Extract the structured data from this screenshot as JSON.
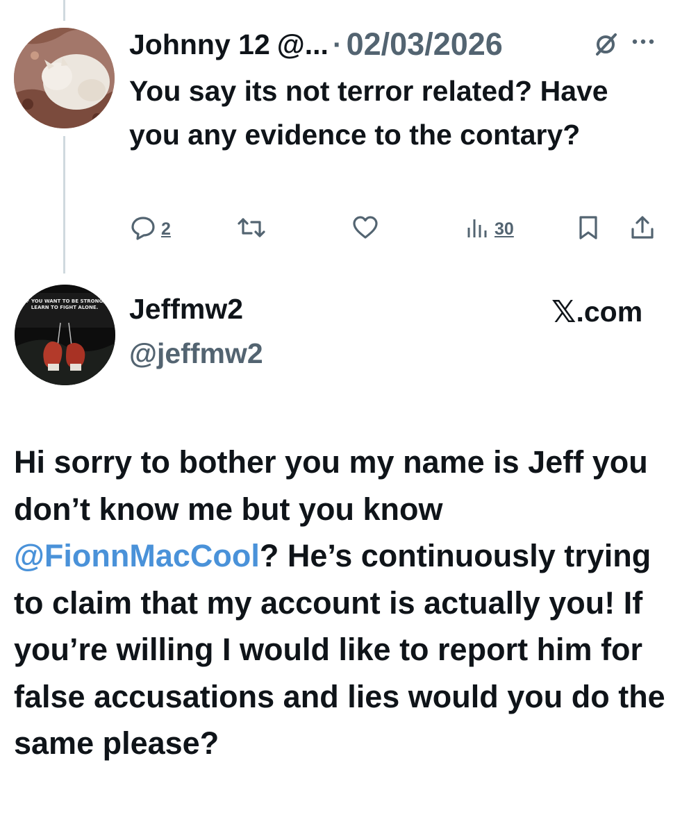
{
  "tweet1": {
    "author_name": "Johnny 12",
    "author_handle": "@...",
    "separator": "·",
    "date": "02/03/2026",
    "text": "You say its not terror related? Have you any evidence to the contary?",
    "replies": "2",
    "views": "30",
    "icons": [
      "reply-icon",
      "retweet-icon",
      "like-icon",
      "views-icon",
      "bookmark-icon",
      "share-icon",
      "grok-icon",
      "more-icon"
    ]
  },
  "tweet2": {
    "author_name": "Jeffmw2",
    "author_handle": "@jeffmw2",
    "avatar_caption": "IF YOU WANT TO BE STRONG, LEARN TO FIGHT ALONE.",
    "site_x": "𝕏",
    "site_text": ".com",
    "text_part1": "Hi sorry to bother you my name is Jeff you don’t know me but you know ",
    "mention": "@FionnMacCool",
    "text_part2": "? He’s continuously trying to claim that my account is actually you! If you’re willing I would like to report him for false accusations and lies would you do the same please?"
  },
  "colors": {
    "text": "#0f1419",
    "secondary": "#536471",
    "mention": "#4a92d9",
    "thread_line": "#cfd9de"
  }
}
